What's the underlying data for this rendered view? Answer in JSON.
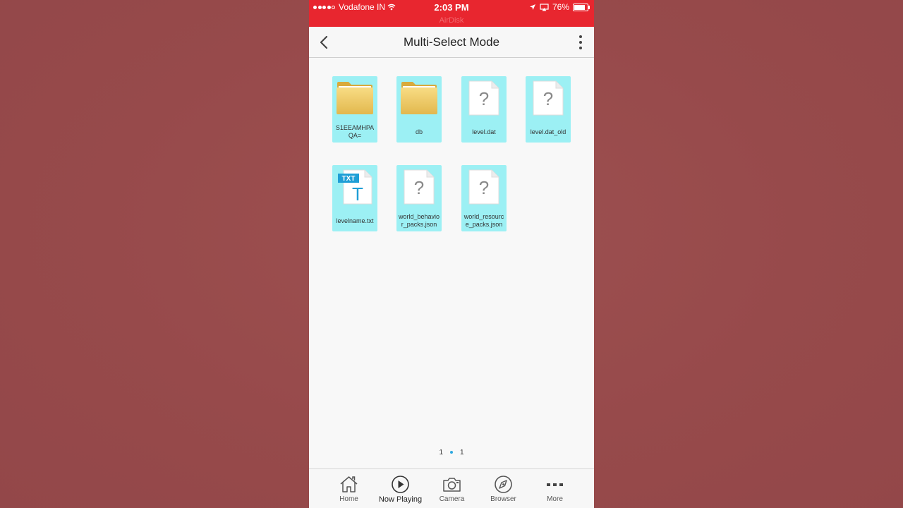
{
  "status_bar": {
    "carrier": "Vodafone IN",
    "time": "2:03 PM",
    "battery": "76%",
    "battery_level": 0.76,
    "background_app_hint": "AirDisk"
  },
  "nav": {
    "title": "Multi-Select Mode",
    "back_icon": "chevron-left-icon",
    "menu_icon": "more-vertical-icon"
  },
  "files": [
    {
      "name_line1": "S1EEAMHPA",
      "name_line2": "QA=",
      "type": "folder"
    },
    {
      "name_line1": "db",
      "name_line2": "",
      "type": "folder"
    },
    {
      "name_line1": "level.dat",
      "name_line2": "",
      "type": "unknown"
    },
    {
      "name_line1": "level.dat_old",
      "name_line2": "",
      "type": "unknown"
    },
    {
      "name_line1": "levelname.txt",
      "name_line2": "",
      "type": "txt",
      "badge": "TXT",
      "glyph": "T"
    },
    {
      "name_line1": "world_behavio",
      "name_line2": "r_packs.json",
      "type": "unknown"
    },
    {
      "name_line1": "world_resourc",
      "name_line2": "e_packs.json",
      "type": "unknown"
    }
  ],
  "pager": {
    "current": "1",
    "total": "1"
  },
  "tabs": [
    {
      "label": "Home",
      "icon": "home-icon"
    },
    {
      "label": "Now Playing",
      "icon": "play-circle-icon"
    },
    {
      "label": "Camera",
      "icon": "camera-icon"
    },
    {
      "label": "Browser",
      "icon": "compass-icon"
    },
    {
      "label": "More",
      "icon": "more-horizontal-icon"
    }
  ],
  "colors": {
    "background": "#974a4b",
    "status_bar": "#e8262f",
    "selection": "#9cf0f4",
    "page_dot": "#2ea8e0"
  }
}
